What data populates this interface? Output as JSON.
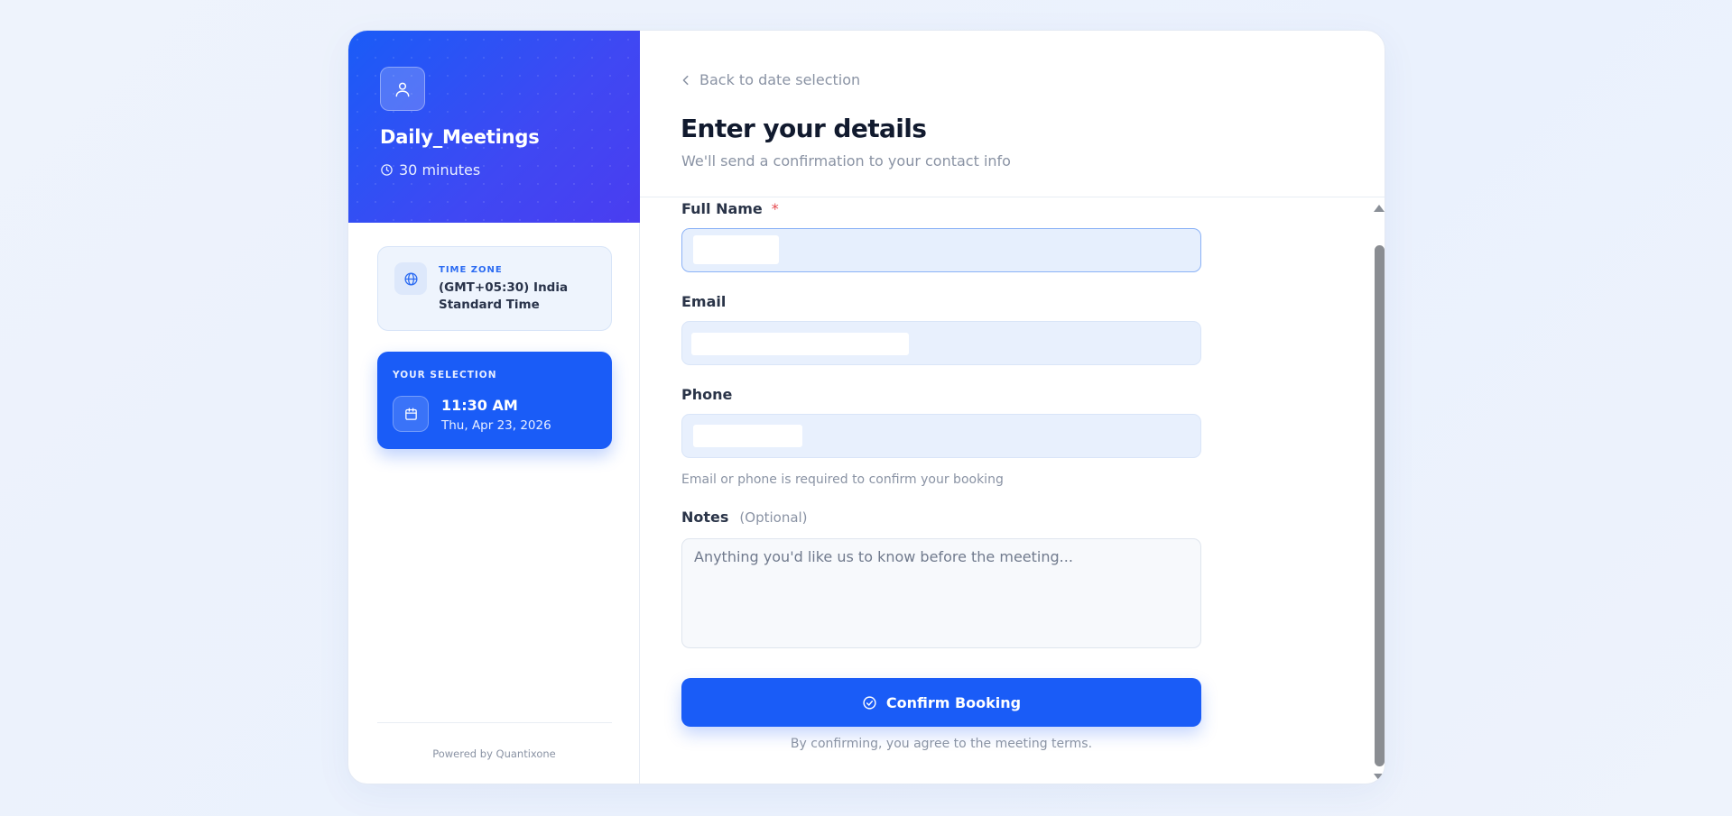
{
  "sidebar": {
    "event_title": "Daily_Meetings",
    "duration": "30 minutes",
    "timezone": {
      "label": "TIME ZONE",
      "value": "(GMT+05:30) India Standard Time"
    },
    "selection": {
      "label": "YOUR SELECTION",
      "time": "11:30 AM",
      "date": "Thu, Apr 23, 2026"
    },
    "powered_by": "Powered by Quantixone"
  },
  "main": {
    "back_label": "Back to date selection",
    "title": "Enter your details",
    "subtitle": "We'll send a confirmation to your contact info",
    "fields": {
      "full_name": {
        "label": "Full Name",
        "required_mark": "*"
      },
      "email": {
        "label": "Email"
      },
      "phone": {
        "label": "Phone"
      },
      "hint": "Email or phone is required to confirm your booking",
      "notes": {
        "label": "Notes",
        "optional_label": "(Optional)",
        "placeholder": "Anything you'd like us to know before the meeting..."
      }
    },
    "confirm_label": "Confirm Booking",
    "terms": "By confirming, you agree to the meeting terms."
  },
  "colors": {
    "accent": "#1a5cf7",
    "required": "#e5484d"
  }
}
